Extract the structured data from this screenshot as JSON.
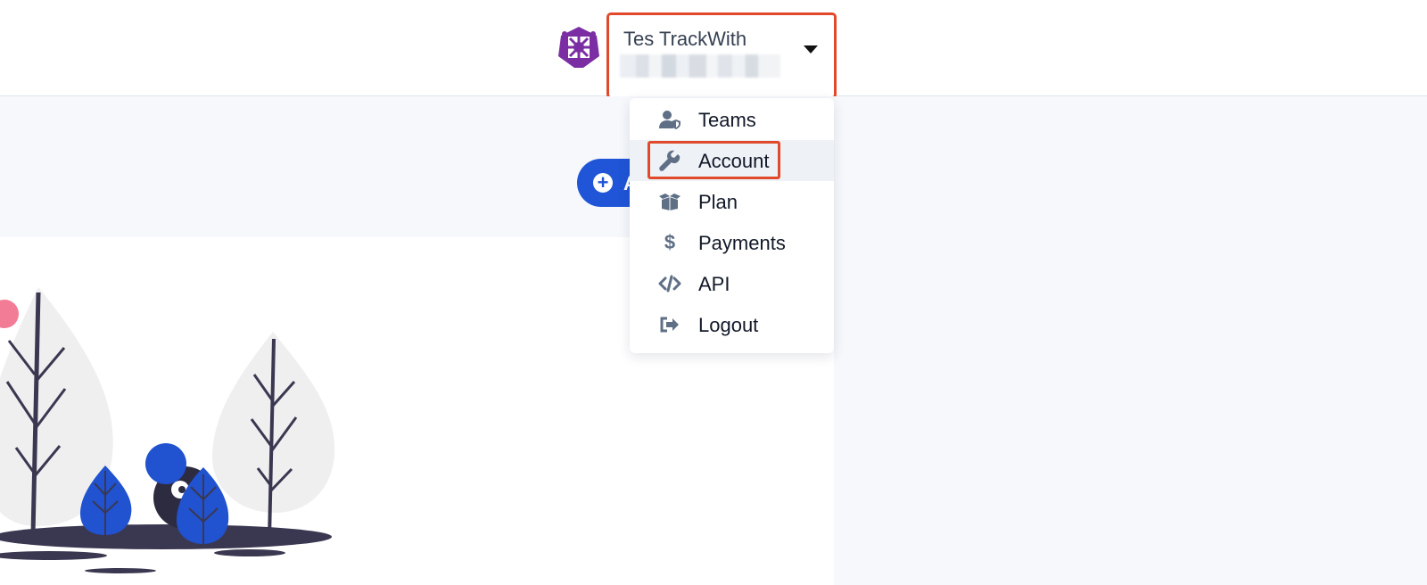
{
  "header": {
    "user_name": "Tes TrackWith"
  },
  "primary_action": {
    "label": "A"
  },
  "user_menu": {
    "items": [
      {
        "label": "Teams",
        "icon": "user-shield-icon"
      },
      {
        "label": "Account",
        "icon": "wrench-icon"
      },
      {
        "label": "Plan",
        "icon": "box-open-icon"
      },
      {
        "label": "Payments",
        "icon": "dollar-icon"
      },
      {
        "label": "API",
        "icon": "code-icon"
      },
      {
        "label": "Logout",
        "icon": "sign-out-icon"
      }
    ],
    "active_item": "Account"
  },
  "colors": {
    "accent": "#1f55d6",
    "highlight_border": "#e04a2b",
    "avatar": "#7b2ea3",
    "band_background": "#f6f8fc"
  }
}
